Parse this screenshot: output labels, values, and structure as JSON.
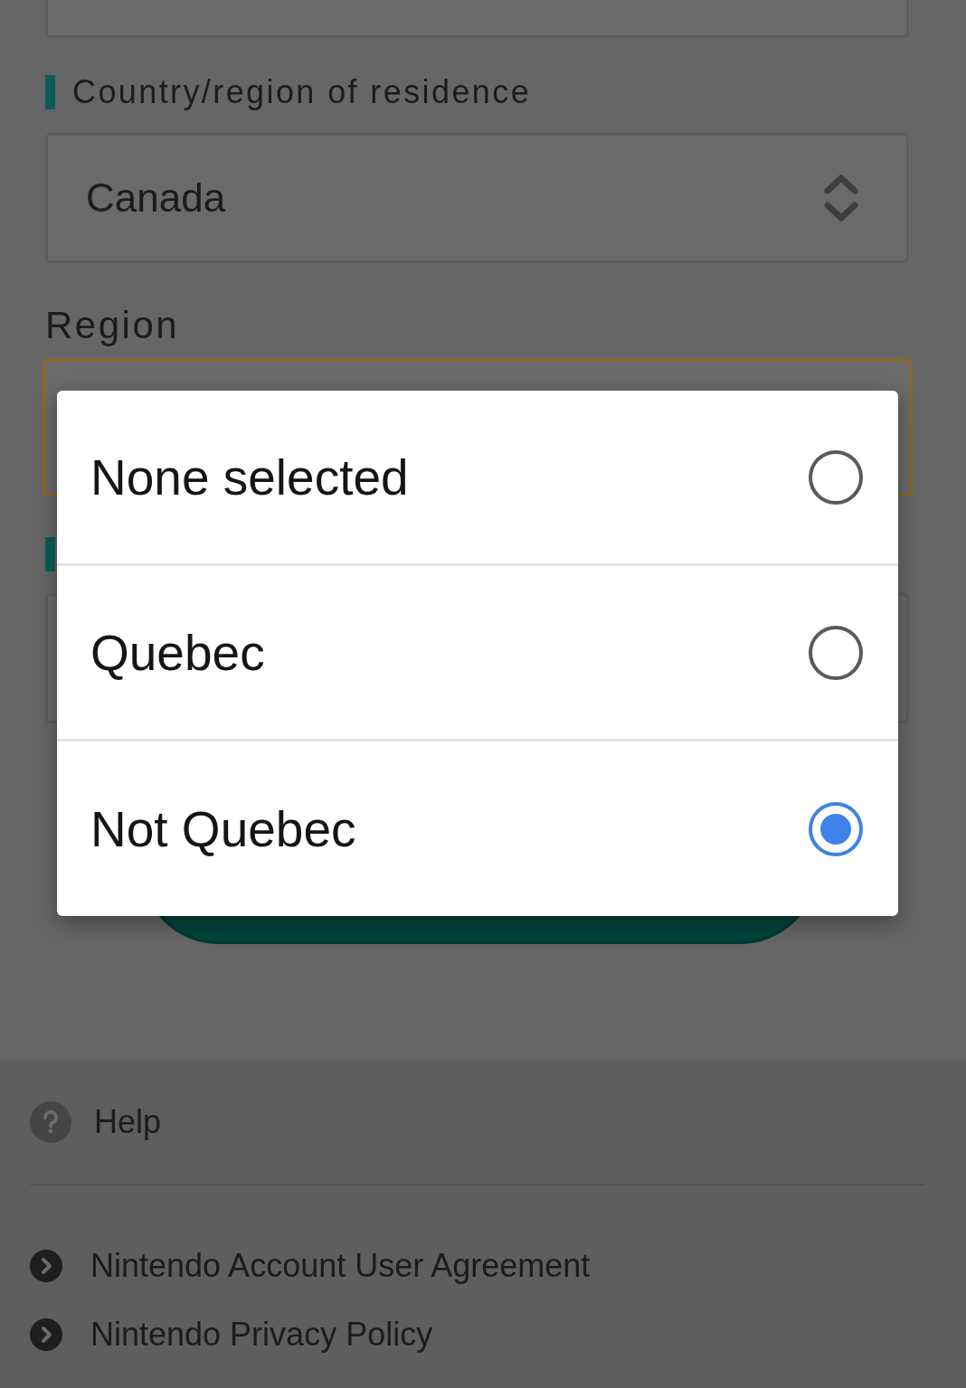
{
  "form": {
    "country_label": "Country/region of residence",
    "country_value": "Canada",
    "region_label": "Region"
  },
  "dialog": {
    "options": [
      {
        "label": "None selected",
        "selected": false
      },
      {
        "label": "Quebec",
        "selected": false
      },
      {
        "label": "Not Quebec",
        "selected": true
      }
    ]
  },
  "footer": {
    "help": "Help",
    "links": [
      "Nintendo Account User Agreement",
      "Nintendo Privacy Policy"
    ]
  }
}
